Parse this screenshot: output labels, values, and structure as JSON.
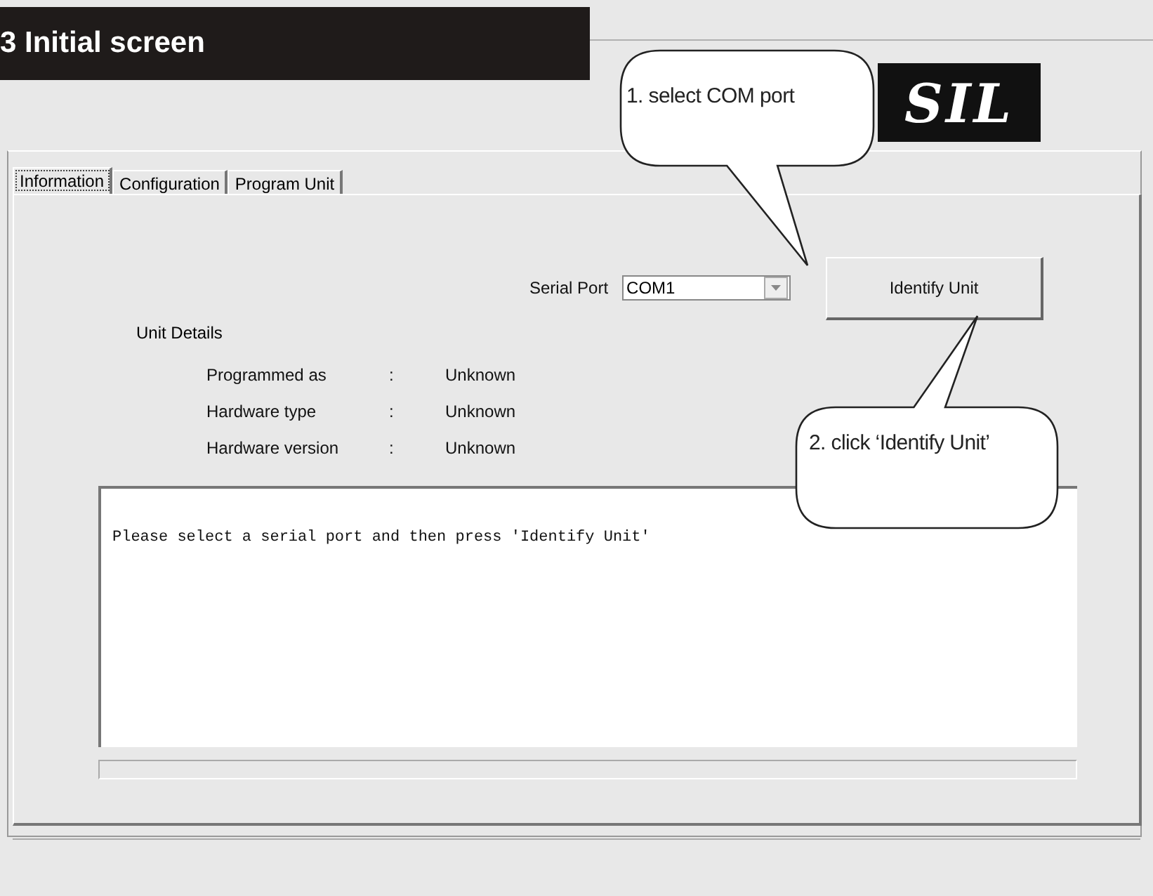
{
  "heading": "3 Initial screen",
  "logo": "SIL",
  "tabs": [
    {
      "label": "Information",
      "selected": true
    },
    {
      "label": "Configuration",
      "selected": false
    },
    {
      "label": "Program Unit",
      "selected": false
    }
  ],
  "serial_port": {
    "label": "Serial Port",
    "value": "COM1"
  },
  "identify_button": "Identify Unit",
  "unit_details": {
    "title": "Unit Details",
    "rows": [
      {
        "label": "Programmed as",
        "separator": ":",
        "value": "Unknown"
      },
      {
        "label": "Hardware type",
        "separator": ":",
        "value": "Unknown"
      },
      {
        "label": "Hardware version",
        "separator": ":",
        "value": "Unknown"
      }
    ]
  },
  "log": "Please select a serial port and then press 'Identify Unit'",
  "callouts": [
    "1. select COM port",
    "2. click ‘Identify Unit’"
  ]
}
